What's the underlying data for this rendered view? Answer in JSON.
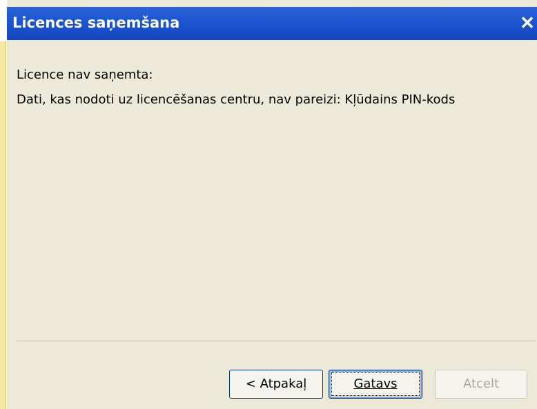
{
  "dialog": {
    "title": "Licences saņemšana",
    "close_icon": "close-icon"
  },
  "message": {
    "line1": "Licence nav saņemta:",
    "line2": "Dati, kas nodoti uz licencēšanas centru, nav pareizi: Kļūdains PIN-kods"
  },
  "buttons": {
    "back_label": "< Atpakaļ",
    "done_label": "Gatavs",
    "cancel_label": "Atcelt"
  },
  "colors": {
    "titlebar": "#1d56d2",
    "dialog_background": "#ece9d8",
    "disabled_text": "#aca899"
  }
}
